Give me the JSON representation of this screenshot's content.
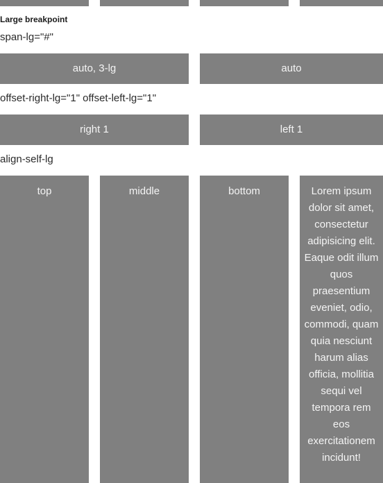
{
  "section": {
    "heading": "Large breakpoint"
  },
  "span_row": {
    "label": "span-lg=\"#\"",
    "cells": [
      "auto, 3-lg",
      "auto"
    ]
  },
  "offset_row": {
    "label": "offset-right-lg=\"1\" offset-left-lg=\"1\"",
    "cells": [
      "right 1",
      "left 1"
    ]
  },
  "align_row": {
    "label": "align-self-lg",
    "cells": [
      "top",
      "middle",
      "bottom",
      "Lorem ipsum dolor sit amet, consectetur adipisicing elit. Eaque odit illum quos praesentium eveniet, odio, commodi, quam quia nesciunt harum alias officia, mollitia sequi vel tempora rem eos exercitationem incidunt!"
    ]
  },
  "colors": {
    "cell_background": "#808080",
    "cell_text": "#f4f4f4",
    "page_background": "#ffffff"
  }
}
